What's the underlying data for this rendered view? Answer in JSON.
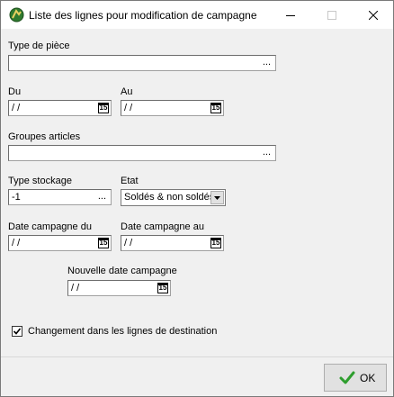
{
  "window": {
    "title": "Liste des lignes pour modification de campagne"
  },
  "titlebar": {
    "minimize_icon": "minimize-icon",
    "maximize_icon": "maximize-icon",
    "close_icon": "close-icon"
  },
  "form": {
    "type_piece": {
      "label": "Type de pièce",
      "value": "",
      "ellipsis": "..."
    },
    "du": {
      "label": "Du",
      "value": " / /",
      "calendar_text": "15"
    },
    "au": {
      "label": "Au",
      "value": " / /",
      "calendar_text": "15"
    },
    "groupes_articles": {
      "label": "Groupes articles",
      "value": "",
      "ellipsis": "..."
    },
    "type_stockage": {
      "label": "Type stockage",
      "value": "-1",
      "ellipsis": "..."
    },
    "etat": {
      "label": "Etat",
      "value": "Soldés & non soldés"
    },
    "date_campagne_du": {
      "label": "Date campagne du",
      "value": " / /",
      "calendar_text": "15"
    },
    "date_campagne_au": {
      "label": "Date campagne au",
      "value": " / /",
      "calendar_text": "15"
    },
    "nouvelle_date_campagne": {
      "label": "Nouvelle date campagne",
      "value": " / /",
      "calendar_text": "15"
    },
    "changement": {
      "label": "Changement dans les lignes de destination",
      "checked": true
    }
  },
  "footer": {
    "ok_label": "OK",
    "ok_color": "#2e9e2e"
  }
}
